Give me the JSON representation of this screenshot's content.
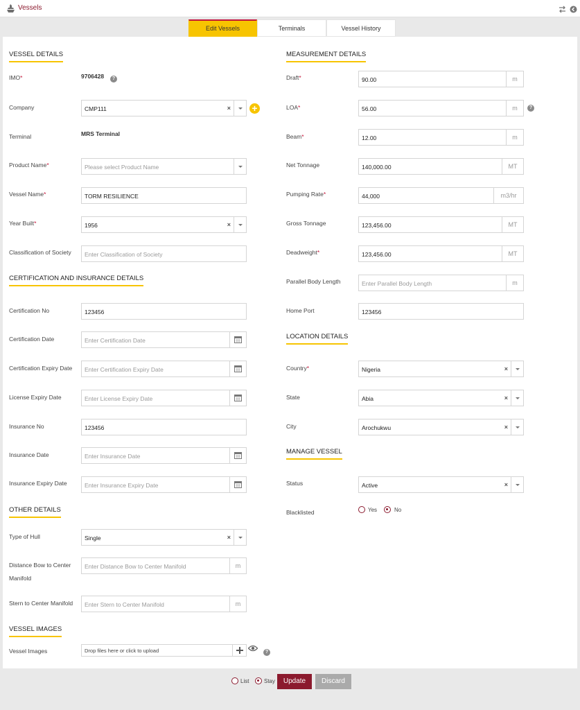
{
  "header": {
    "title": "Vessels"
  },
  "tabs": [
    {
      "label": "Edit Vessels"
    },
    {
      "label": "Terminals"
    },
    {
      "label": "Vessel History"
    }
  ],
  "sections": {
    "vessel_details": "VESSEL DETAILS",
    "certification": "CERTIFICATION AND INSURANCE DETAILS",
    "other": "OTHER DETAILS",
    "images": "VESSEL IMAGES",
    "measurement": "MEASUREMENT DETAILS",
    "location": "LOCATION DETAILS",
    "manage": "MANAGE VESSEL"
  },
  "vessel": {
    "imo_label": "IMO",
    "imo_value": "9706428",
    "company_label": "Company",
    "company_value": "CMP111",
    "terminal_label": "Terminal",
    "terminal_value": "MRS Terminal",
    "product_label": "Product Name",
    "product_placeholder": "Please select Product Name",
    "name_label": "Vessel Name",
    "name_value": "TORM RESILIENCE",
    "year_label": "Year Built",
    "year_value": "1956",
    "class_label": "Classification of Society",
    "class_placeholder": "Enter Classification of Society"
  },
  "cert": {
    "no_label": "Certification No",
    "no_value": "123456",
    "date_label": "Certification Date",
    "date_placeholder": "Enter Certification Date",
    "expiry_label": "Certification Expiry Date",
    "expiry_placeholder": "Enter Certification Expiry Date",
    "license_label": "License Expiry Date",
    "license_placeholder": "Enter License Expiry Date",
    "ins_no_label": "Insurance No",
    "ins_no_value": "123456",
    "ins_date_label": "Insurance Date",
    "ins_date_placeholder": "Enter Insurance Date",
    "ins_expiry_label": "Insurance Expiry Date",
    "ins_expiry_placeholder": "Enter Insurance Expiry Date"
  },
  "other": {
    "hull_label": "Type of Hull",
    "hull_value": "Single",
    "bow_label_1": "Distance Bow to Center",
    "bow_label_2": "Manifold",
    "bow_placeholder": "Enter Distance Bow to Center Manifold",
    "bow_unit": "m",
    "stern_label": "Stern to Center Manifold",
    "stern_placeholder": "Enter Stern to Center Manifold",
    "stern_unit": "m"
  },
  "images": {
    "label": "Vessel Images",
    "drop_text": "Drop files here or click to upload"
  },
  "measurement": {
    "draft_label": "Draft",
    "draft_value": "90.00",
    "draft_unit": "m",
    "loa_label": "LOA",
    "loa_value": "56.00",
    "loa_unit": "m",
    "beam_label": "Beam",
    "beam_value": "12.00",
    "beam_unit": "m",
    "net_label": "Net Tonnage",
    "net_value": "140,000.00",
    "net_unit": "MT",
    "pump_label": "Pumping Rate",
    "pump_value": "44,000",
    "pump_unit": "m3/hr",
    "gross_label": "Gross Tonnage",
    "gross_value": "123,456.00",
    "gross_unit": "MT",
    "dead_label": "Deadweight",
    "dead_value": "123,456.00",
    "dead_unit": "MT",
    "pbl_label": "Parallel Body Length",
    "pbl_placeholder": "Enter Parallel Body Length",
    "pbl_unit": "m",
    "port_label": "Home Port",
    "port_value": "123456"
  },
  "location": {
    "country_label": "Country",
    "country_value": "Nigeria",
    "state_label": "State",
    "state_value": "Abia",
    "city_label": "City",
    "city_value": "Arochukwu"
  },
  "manage": {
    "status_label": "Status",
    "status_value": "Active",
    "black_label": "Blacklisted",
    "yes_label": "Yes",
    "no_label": "No"
  },
  "footer": {
    "list_label": "List",
    "stay_label": "Stay",
    "update_label": "Update",
    "discard_label": "Discard"
  },
  "colors": {
    "brand": "#8b1a2e",
    "accent": "#f7c401",
    "discard": "#aaaaaa"
  },
  "required_marker": "*",
  "help_glyph": "?",
  "clear_glyph": "×",
  "plus_glyph": "+"
}
